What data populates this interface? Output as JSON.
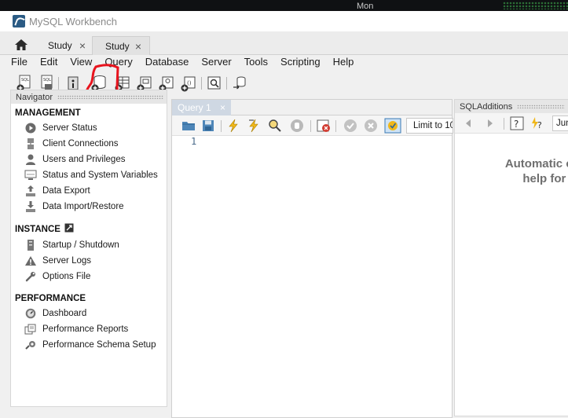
{
  "desktop": {
    "label": "Mon"
  },
  "window": {
    "title": "MySQL Workbench"
  },
  "tabs": [
    {
      "label": "Study",
      "close": "×"
    },
    {
      "label": "Study",
      "close": "×"
    }
  ],
  "menu": [
    "File",
    "Edit",
    "View",
    "Query",
    "Database",
    "Server",
    "Tools",
    "Scripting",
    "Help"
  ],
  "navigator": {
    "title": "Navigator",
    "sections": [
      {
        "title": "MANAGEMENT",
        "items": [
          "Server Status",
          "Client Connections",
          "Users and Privileges",
          "Status and System Variables",
          "Data Export",
          "Data Import/Restore"
        ]
      },
      {
        "title": "INSTANCE",
        "items": [
          "Startup / Shutdown",
          "Server Logs",
          "Options File"
        ]
      },
      {
        "title": "PERFORMANCE",
        "items": [
          "Dashboard",
          "Performance Reports",
          "Performance Schema Setup"
        ]
      }
    ]
  },
  "editor": {
    "tab_label": "Query 1",
    "tab_close": "×",
    "limit_label": "Limit to 10",
    "line_number": "1"
  },
  "sql_additions": {
    "title": "SQLAdditions",
    "jump_label": "Jun",
    "help_line1": "Automatic con",
    "help_line2": "help for the"
  },
  "colors": {
    "annotation": "#e8141e",
    "accent": "#2b5b84"
  }
}
